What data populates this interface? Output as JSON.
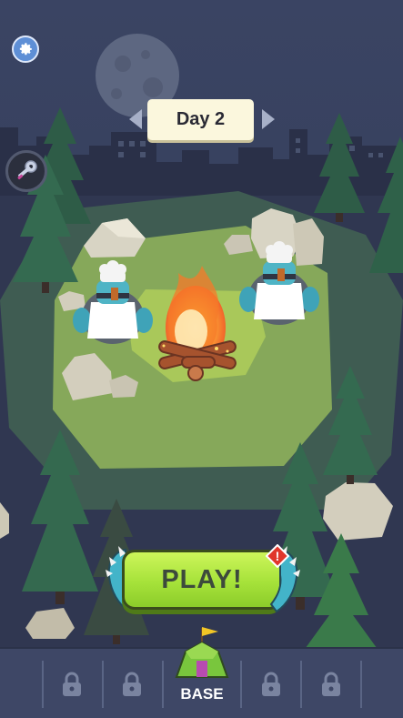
{
  "day_selector": {
    "label": "Day 2"
  },
  "play_button": {
    "label": "PLAY!"
  },
  "alert_badge": {
    "symbol": "!",
    "color": "#e0362b"
  },
  "bottom_nav": {
    "base_label": "BASE",
    "locked_slots": 4
  },
  "icons": {
    "settings": "gear-icon",
    "inventory": "key-icon",
    "previous_day": "chevron-left-icon",
    "next_day": "chevron-right-icon",
    "lock": "padlock-icon",
    "base": "tent-icon"
  },
  "colors": {
    "sky": "#38425e",
    "clearing": "#a9c85a",
    "play_button": "#a6e23a",
    "bottom_bar": "#3e4766"
  }
}
